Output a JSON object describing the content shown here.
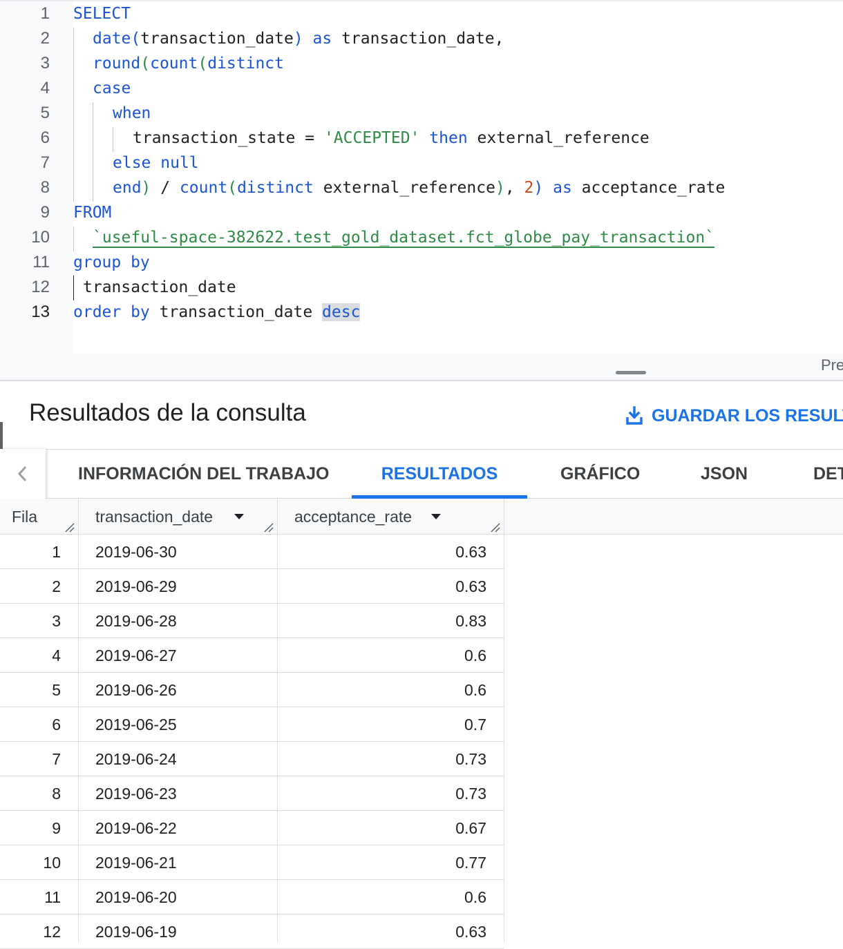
{
  "editor": {
    "lines": [
      {
        "n": "1",
        "tokens": [
          [
            "kw",
            "SELECT"
          ]
        ]
      },
      {
        "n": "2",
        "tokens": [
          [
            "fn",
            "date"
          ],
          [
            "fn",
            "("
          ],
          [
            "tx",
            "transaction_date"
          ],
          [
            "fn",
            ")"
          ],
          [
            "tx",
            " "
          ],
          [
            "kw",
            "as"
          ],
          [
            "tx",
            " transaction_date,"
          ]
        ]
      },
      {
        "n": "3",
        "tokens": [
          [
            "fn",
            "round"
          ],
          [
            "pn",
            "("
          ],
          [
            "fn",
            "count"
          ],
          [
            "pn",
            "("
          ],
          [
            "kw",
            "distinct"
          ]
        ]
      },
      {
        "n": "4",
        "tokens": [
          [
            "kw",
            "case"
          ]
        ]
      },
      {
        "n": "5",
        "tokens": [
          [
            "kw",
            "when"
          ]
        ]
      },
      {
        "n": "6",
        "tokens": [
          [
            "tx",
            "transaction_state = "
          ],
          [
            "str",
            "'ACCEPTED'"
          ],
          [
            "tx",
            " "
          ],
          [
            "kw",
            "then"
          ],
          [
            "tx",
            " external_reference"
          ]
        ]
      },
      {
        "n": "7",
        "tokens": [
          [
            "kw",
            "else"
          ],
          [
            "tx",
            " "
          ],
          [
            "kw",
            "null"
          ]
        ]
      },
      {
        "n": "8",
        "tokens": [
          [
            "kw",
            "end"
          ],
          [
            "pn",
            ")"
          ],
          [
            "tx",
            " / "
          ],
          [
            "fn",
            "count"
          ],
          [
            "pn",
            "("
          ],
          [
            "kw",
            "distinct"
          ],
          [
            "tx",
            " external_reference"
          ],
          [
            "pn",
            ")"
          ],
          [
            "tx",
            ", "
          ],
          [
            "num",
            "2"
          ],
          [
            "fn",
            ")"
          ],
          [
            "tx",
            " "
          ],
          [
            "kw",
            "as"
          ],
          [
            "tx",
            " acceptance_rate"
          ]
        ]
      },
      {
        "n": "9",
        "tokens": [
          [
            "kw",
            "FROM"
          ]
        ]
      },
      {
        "n": "10",
        "tokens": [
          [
            "lit",
            "`useful-space-382622.test_gold_dataset.fct_globe_pay_transaction`"
          ]
        ]
      },
      {
        "n": "11",
        "tokens": [
          [
            "kw",
            "group by"
          ]
        ]
      },
      {
        "n": "12",
        "tokens": [
          [
            "tx",
            "transaction_date"
          ]
        ]
      },
      {
        "n": "13",
        "tokens": [
          [
            "kw",
            "order by"
          ],
          [
            "tx",
            " transaction_date "
          ],
          [
            "kw hl",
            "desc"
          ]
        ]
      }
    ],
    "pane_label": "Pre"
  },
  "results": {
    "title": "Resultados de la consulta",
    "save_label": "GUARDAR LOS RESULTA",
    "tabs": [
      {
        "label": "INFORMACIÓN DEL TRABAJO"
      },
      {
        "label": "RESULTADOS"
      },
      {
        "label": "GRÁFICO"
      },
      {
        "label": "JSON"
      },
      {
        "label": "DET"
      }
    ],
    "active_tab": "RESULTADOS",
    "columns": [
      "Fila",
      "transaction_date",
      "acceptance_rate"
    ],
    "rows": [
      {
        "idx": "1",
        "date": "2019-06-30",
        "rate": "0.63"
      },
      {
        "idx": "2",
        "date": "2019-06-29",
        "rate": "0.63"
      },
      {
        "idx": "3",
        "date": "2019-06-28",
        "rate": "0.83"
      },
      {
        "idx": "4",
        "date": "2019-06-27",
        "rate": "0.6"
      },
      {
        "idx": "5",
        "date": "2019-06-26",
        "rate": "0.6"
      },
      {
        "idx": "6",
        "date": "2019-06-25",
        "rate": "0.7"
      },
      {
        "idx": "7",
        "date": "2019-06-24",
        "rate": "0.73"
      },
      {
        "idx": "8",
        "date": "2019-06-23",
        "rate": "0.73"
      },
      {
        "idx": "9",
        "date": "2019-06-22",
        "rate": "0.67"
      },
      {
        "idx": "10",
        "date": "2019-06-21",
        "rate": "0.77"
      },
      {
        "idx": "11",
        "date": "2019-06-20",
        "rate": "0.6"
      },
      {
        "idx": "12",
        "date": "2019-06-19",
        "rate": "0.63"
      }
    ]
  },
  "icons": {
    "download": "download-icon",
    "chevron_left": "chevron-left-icon",
    "sort": "sort-desc-icon",
    "resize": "column-resize-icon"
  },
  "colors": {
    "accent": "#1a73e8",
    "keyword": "#1a55d6",
    "string": "#2e8b45",
    "number": "#d2451e"
  }
}
